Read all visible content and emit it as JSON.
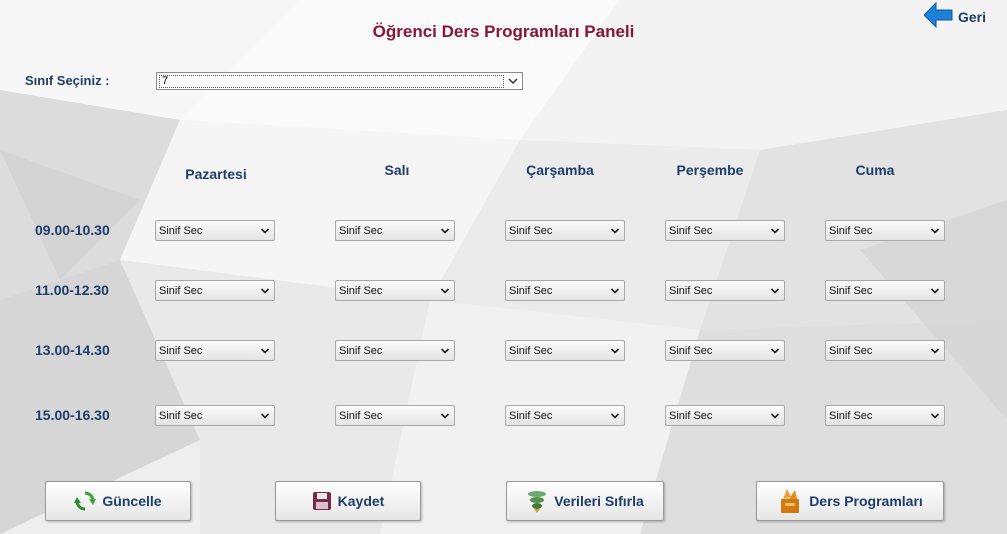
{
  "title": "Öğrenci Ders Programları Paneli",
  "back": {
    "label": "Geri",
    "icon": "arrow-left-icon"
  },
  "class_select": {
    "label": "Sınıf Seçiniz :",
    "value": "7"
  },
  "days": [
    "Pazartesi",
    "Salı",
    "Çarşamba",
    "Perşembe",
    "Cuma"
  ],
  "times": [
    "09.00-10.30",
    "11.00-12.30",
    "13.00-14.30",
    "15.00-16.30"
  ],
  "slot_value": "Sinif Sec",
  "buttons": {
    "update": {
      "label": "Güncelle",
      "icon": "refresh-icon"
    },
    "save": {
      "label": "Kaydet",
      "icon": "floppy-disk-icon"
    },
    "reset": {
      "label": "Verileri Sıfırla",
      "icon": "reset-icon"
    },
    "programs": {
      "label": "Ders Programları",
      "icon": "programs-icon"
    }
  },
  "colors": {
    "title": "#8b1538",
    "text": "#1c3d6e",
    "accent": "#1e7fd8"
  }
}
